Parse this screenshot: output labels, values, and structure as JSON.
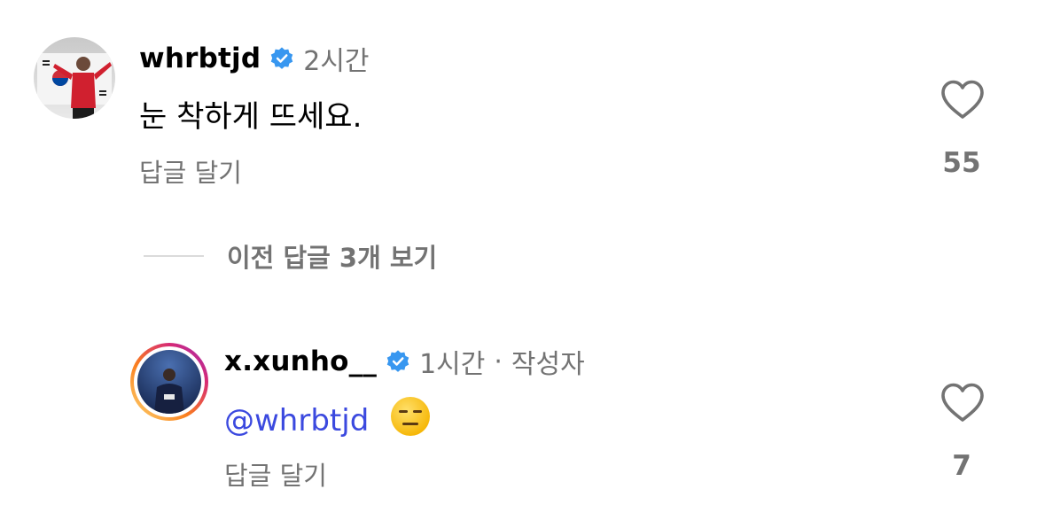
{
  "comments": [
    {
      "username": "whrbtjd",
      "verified": true,
      "time": "2시간",
      "text": "눈 착하게 뜨세요.",
      "reply_label": "답글 달기",
      "likes": "55"
    }
  ],
  "view_more_replies": "이전 답글 3개 보기",
  "reply": {
    "username": "x.xunho__",
    "verified": true,
    "time": "1시간",
    "separator": "·",
    "author_badge": "작성자",
    "mention": "@whrbtjd",
    "emoji": "😑",
    "reply_label": "답글 달기",
    "likes": "7"
  },
  "colors": {
    "verified_badge": "#3897f0",
    "mention": "#3b49df",
    "secondary_text": "#737373",
    "story_ring_start": "#feda75",
    "story_ring_end": "#d62976"
  }
}
